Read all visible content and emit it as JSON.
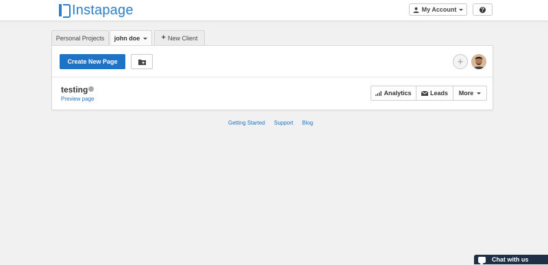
{
  "header": {
    "logo_text": "Instapage",
    "account_label": "My Account",
    "help_label": "?"
  },
  "tabs": [
    {
      "label": "Personal Projects",
      "active": false
    },
    {
      "label": "john doe",
      "active": true
    },
    {
      "label": "New Client",
      "active": false
    }
  ],
  "toolbar": {
    "create_label": "Create New Page",
    "add_member_label": "+"
  },
  "page_item": {
    "name": "testing",
    "status_color": "#aaaaaa",
    "preview_label": "Preview page",
    "actions": {
      "analytics": "Analytics",
      "leads": "Leads",
      "more": "More"
    }
  },
  "footer": {
    "links": [
      "Getting Started",
      "Support",
      "Blog"
    ]
  },
  "chat": {
    "label": "Chat with us"
  },
  "colors": {
    "accent": "#1e73c7",
    "chat_bg": "#1f3046"
  }
}
